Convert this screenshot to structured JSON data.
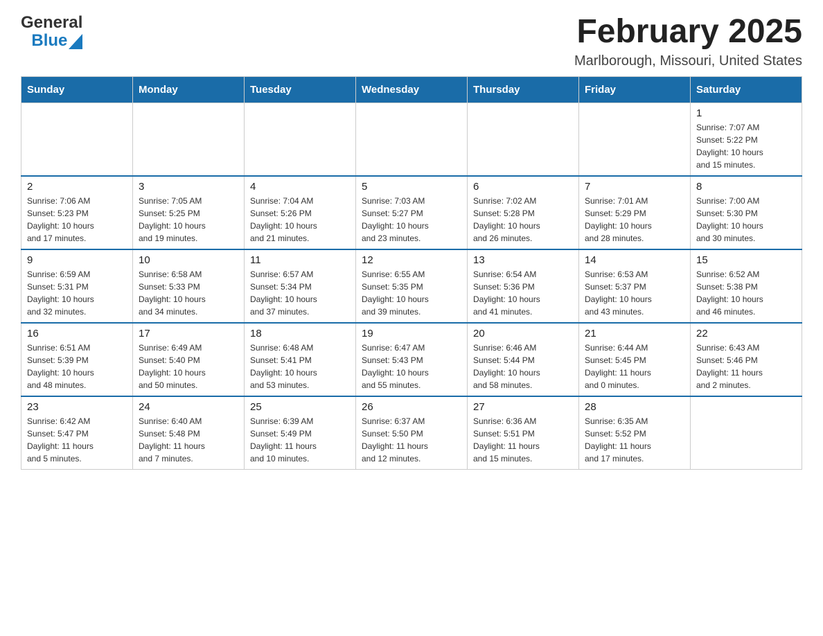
{
  "header": {
    "logo_general": "General",
    "logo_blue": "Blue",
    "month_title": "February 2025",
    "location": "Marlborough, Missouri, United States"
  },
  "weekdays": [
    "Sunday",
    "Monday",
    "Tuesday",
    "Wednesday",
    "Thursday",
    "Friday",
    "Saturday"
  ],
  "weeks": [
    [
      {
        "day": "",
        "info": ""
      },
      {
        "day": "",
        "info": ""
      },
      {
        "day": "",
        "info": ""
      },
      {
        "day": "",
        "info": ""
      },
      {
        "day": "",
        "info": ""
      },
      {
        "day": "",
        "info": ""
      },
      {
        "day": "1",
        "info": "Sunrise: 7:07 AM\nSunset: 5:22 PM\nDaylight: 10 hours\nand 15 minutes."
      }
    ],
    [
      {
        "day": "2",
        "info": "Sunrise: 7:06 AM\nSunset: 5:23 PM\nDaylight: 10 hours\nand 17 minutes."
      },
      {
        "day": "3",
        "info": "Sunrise: 7:05 AM\nSunset: 5:25 PM\nDaylight: 10 hours\nand 19 minutes."
      },
      {
        "day": "4",
        "info": "Sunrise: 7:04 AM\nSunset: 5:26 PM\nDaylight: 10 hours\nand 21 minutes."
      },
      {
        "day": "5",
        "info": "Sunrise: 7:03 AM\nSunset: 5:27 PM\nDaylight: 10 hours\nand 23 minutes."
      },
      {
        "day": "6",
        "info": "Sunrise: 7:02 AM\nSunset: 5:28 PM\nDaylight: 10 hours\nand 26 minutes."
      },
      {
        "day": "7",
        "info": "Sunrise: 7:01 AM\nSunset: 5:29 PM\nDaylight: 10 hours\nand 28 minutes."
      },
      {
        "day": "8",
        "info": "Sunrise: 7:00 AM\nSunset: 5:30 PM\nDaylight: 10 hours\nand 30 minutes."
      }
    ],
    [
      {
        "day": "9",
        "info": "Sunrise: 6:59 AM\nSunset: 5:31 PM\nDaylight: 10 hours\nand 32 minutes."
      },
      {
        "day": "10",
        "info": "Sunrise: 6:58 AM\nSunset: 5:33 PM\nDaylight: 10 hours\nand 34 minutes."
      },
      {
        "day": "11",
        "info": "Sunrise: 6:57 AM\nSunset: 5:34 PM\nDaylight: 10 hours\nand 37 minutes."
      },
      {
        "day": "12",
        "info": "Sunrise: 6:55 AM\nSunset: 5:35 PM\nDaylight: 10 hours\nand 39 minutes."
      },
      {
        "day": "13",
        "info": "Sunrise: 6:54 AM\nSunset: 5:36 PM\nDaylight: 10 hours\nand 41 minutes."
      },
      {
        "day": "14",
        "info": "Sunrise: 6:53 AM\nSunset: 5:37 PM\nDaylight: 10 hours\nand 43 minutes."
      },
      {
        "day": "15",
        "info": "Sunrise: 6:52 AM\nSunset: 5:38 PM\nDaylight: 10 hours\nand 46 minutes."
      }
    ],
    [
      {
        "day": "16",
        "info": "Sunrise: 6:51 AM\nSunset: 5:39 PM\nDaylight: 10 hours\nand 48 minutes."
      },
      {
        "day": "17",
        "info": "Sunrise: 6:49 AM\nSunset: 5:40 PM\nDaylight: 10 hours\nand 50 minutes."
      },
      {
        "day": "18",
        "info": "Sunrise: 6:48 AM\nSunset: 5:41 PM\nDaylight: 10 hours\nand 53 minutes."
      },
      {
        "day": "19",
        "info": "Sunrise: 6:47 AM\nSunset: 5:43 PM\nDaylight: 10 hours\nand 55 minutes."
      },
      {
        "day": "20",
        "info": "Sunrise: 6:46 AM\nSunset: 5:44 PM\nDaylight: 10 hours\nand 58 minutes."
      },
      {
        "day": "21",
        "info": "Sunrise: 6:44 AM\nSunset: 5:45 PM\nDaylight: 11 hours\nand 0 minutes."
      },
      {
        "day": "22",
        "info": "Sunrise: 6:43 AM\nSunset: 5:46 PM\nDaylight: 11 hours\nand 2 minutes."
      }
    ],
    [
      {
        "day": "23",
        "info": "Sunrise: 6:42 AM\nSunset: 5:47 PM\nDaylight: 11 hours\nand 5 minutes."
      },
      {
        "day": "24",
        "info": "Sunrise: 6:40 AM\nSunset: 5:48 PM\nDaylight: 11 hours\nand 7 minutes."
      },
      {
        "day": "25",
        "info": "Sunrise: 6:39 AM\nSunset: 5:49 PM\nDaylight: 11 hours\nand 10 minutes."
      },
      {
        "day": "26",
        "info": "Sunrise: 6:37 AM\nSunset: 5:50 PM\nDaylight: 11 hours\nand 12 minutes."
      },
      {
        "day": "27",
        "info": "Sunrise: 6:36 AM\nSunset: 5:51 PM\nDaylight: 11 hours\nand 15 minutes."
      },
      {
        "day": "28",
        "info": "Sunrise: 6:35 AM\nSunset: 5:52 PM\nDaylight: 11 hours\nand 17 minutes."
      },
      {
        "day": "",
        "info": ""
      }
    ]
  ]
}
